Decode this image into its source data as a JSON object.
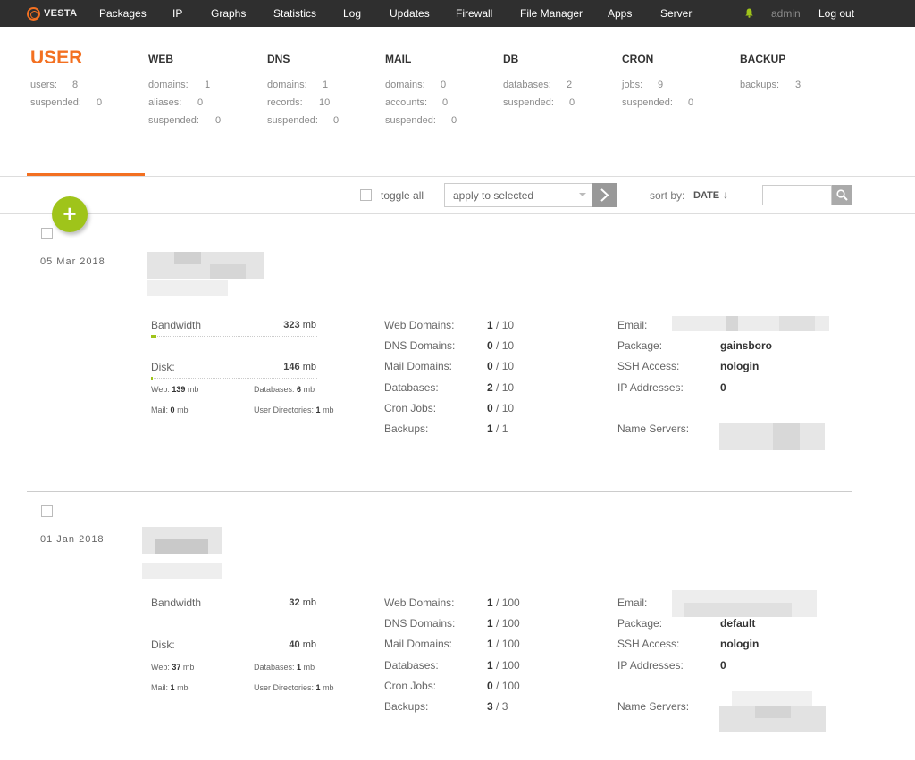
{
  "app": {
    "logo_text": "VESTA"
  },
  "nav": {
    "items": [
      "Packages",
      "IP",
      "Graphs",
      "Statistics",
      "Log",
      "Updates",
      "Firewall",
      "File Manager",
      "Apps",
      "Server"
    ],
    "user": "admin",
    "logout": "Log out"
  },
  "summary": {
    "user": {
      "title": "USER",
      "rows": [
        {
          "label": "users:",
          "value": "8"
        },
        {
          "label": "suspended:",
          "value": "0"
        }
      ]
    },
    "web": {
      "title": "WEB",
      "rows": [
        {
          "label": "domains:",
          "value": "1"
        },
        {
          "label": "aliases:",
          "value": "0"
        },
        {
          "label": "suspended:",
          "value": "0"
        }
      ]
    },
    "dns": {
      "title": "DNS",
      "rows": [
        {
          "label": "domains:",
          "value": "1"
        },
        {
          "label": "records:",
          "value": "10"
        },
        {
          "label": "suspended:",
          "value": "0"
        }
      ]
    },
    "mail": {
      "title": "MAIL",
      "rows": [
        {
          "label": "domains:",
          "value": "0"
        },
        {
          "label": "accounts:",
          "value": "0"
        },
        {
          "label": "suspended:",
          "value": "0"
        }
      ]
    },
    "db": {
      "title": "DB",
      "rows": [
        {
          "label": "databases:",
          "value": "2"
        },
        {
          "label": "suspended:",
          "value": "0"
        }
      ]
    },
    "cron": {
      "title": "CRON",
      "rows": [
        {
          "label": "jobs:",
          "value": "9"
        },
        {
          "label": "suspended:",
          "value": "0"
        }
      ]
    },
    "backup": {
      "title": "BACKUP",
      "rows": [
        {
          "label": "backups:",
          "value": "3"
        }
      ]
    }
  },
  "toolbar": {
    "toggle_all": "toggle all",
    "apply_placeholder": "apply to selected",
    "sort_label": "sort by:",
    "sort_value": "DATE",
    "sort_arrow": "↓"
  },
  "labels": {
    "bandwidth": "Bandwidth",
    "disk": "Disk:",
    "web": "Web:",
    "databases": "Databases:",
    "mail": "Mail:",
    "user_dirs": "User Directories:",
    "unit": "mb",
    "web_domains": "Web Domains:",
    "dns_domains": "DNS Domains:",
    "mail_domains": "Mail Domains:",
    "databases_col": "Databases:",
    "cron_jobs": "Cron Jobs:",
    "backups": "Backups:",
    "email": "Email:",
    "package": "Package:",
    "ssh": "SSH Access:",
    "ip": "IP Addresses:",
    "ns": "Name Servers:"
  },
  "users": [
    {
      "date": "05 Mar 2018",
      "bandwidth": "323",
      "bandwidth_usage": 0.03,
      "disk": "146",
      "disk_usage": 0.01,
      "web": "139",
      "databases": "6",
      "mail": "0",
      "user_dirs": "1",
      "web_domains": {
        "used": "1",
        "limit": "/ 10"
      },
      "dns_domains": {
        "used": "0",
        "limit": "/ 10"
      },
      "mail_domains": {
        "used": "0",
        "limit": "/ 10"
      },
      "databases_col": {
        "used": "2",
        "limit": "/ 10"
      },
      "cron_jobs": {
        "used": "0",
        "limit": "/ 10"
      },
      "backups": {
        "used": "1",
        "limit": "/ 1"
      },
      "package": "gainsboro",
      "ssh": "nologin",
      "ip": "0"
    },
    {
      "date": "01 Jan 2018",
      "bandwidth": "32",
      "bandwidth_usage": 0,
      "disk": "40",
      "disk_usage": 0,
      "web": "37",
      "databases": "1",
      "mail": "1",
      "user_dirs": "1",
      "web_domains": {
        "used": "1",
        "limit": "/ 100"
      },
      "dns_domains": {
        "used": "1",
        "limit": "/ 100"
      },
      "mail_domains": {
        "used": "1",
        "limit": "/ 100"
      },
      "databases_col": {
        "used": "1",
        "limit": "/ 100"
      },
      "cron_jobs": {
        "used": "0",
        "limit": "/ 100"
      },
      "backups": {
        "used": "3",
        "limit": "/ 3"
      },
      "package": "default",
      "ssh": "nologin",
      "ip": "0"
    }
  ],
  "colors": {
    "accent": "#f37021",
    "green": "#9fc41a",
    "topbar": "#2f2f2f"
  },
  "icons": [
    "bell-icon",
    "search-icon",
    "plus-icon",
    "arrow-right-icon"
  ]
}
